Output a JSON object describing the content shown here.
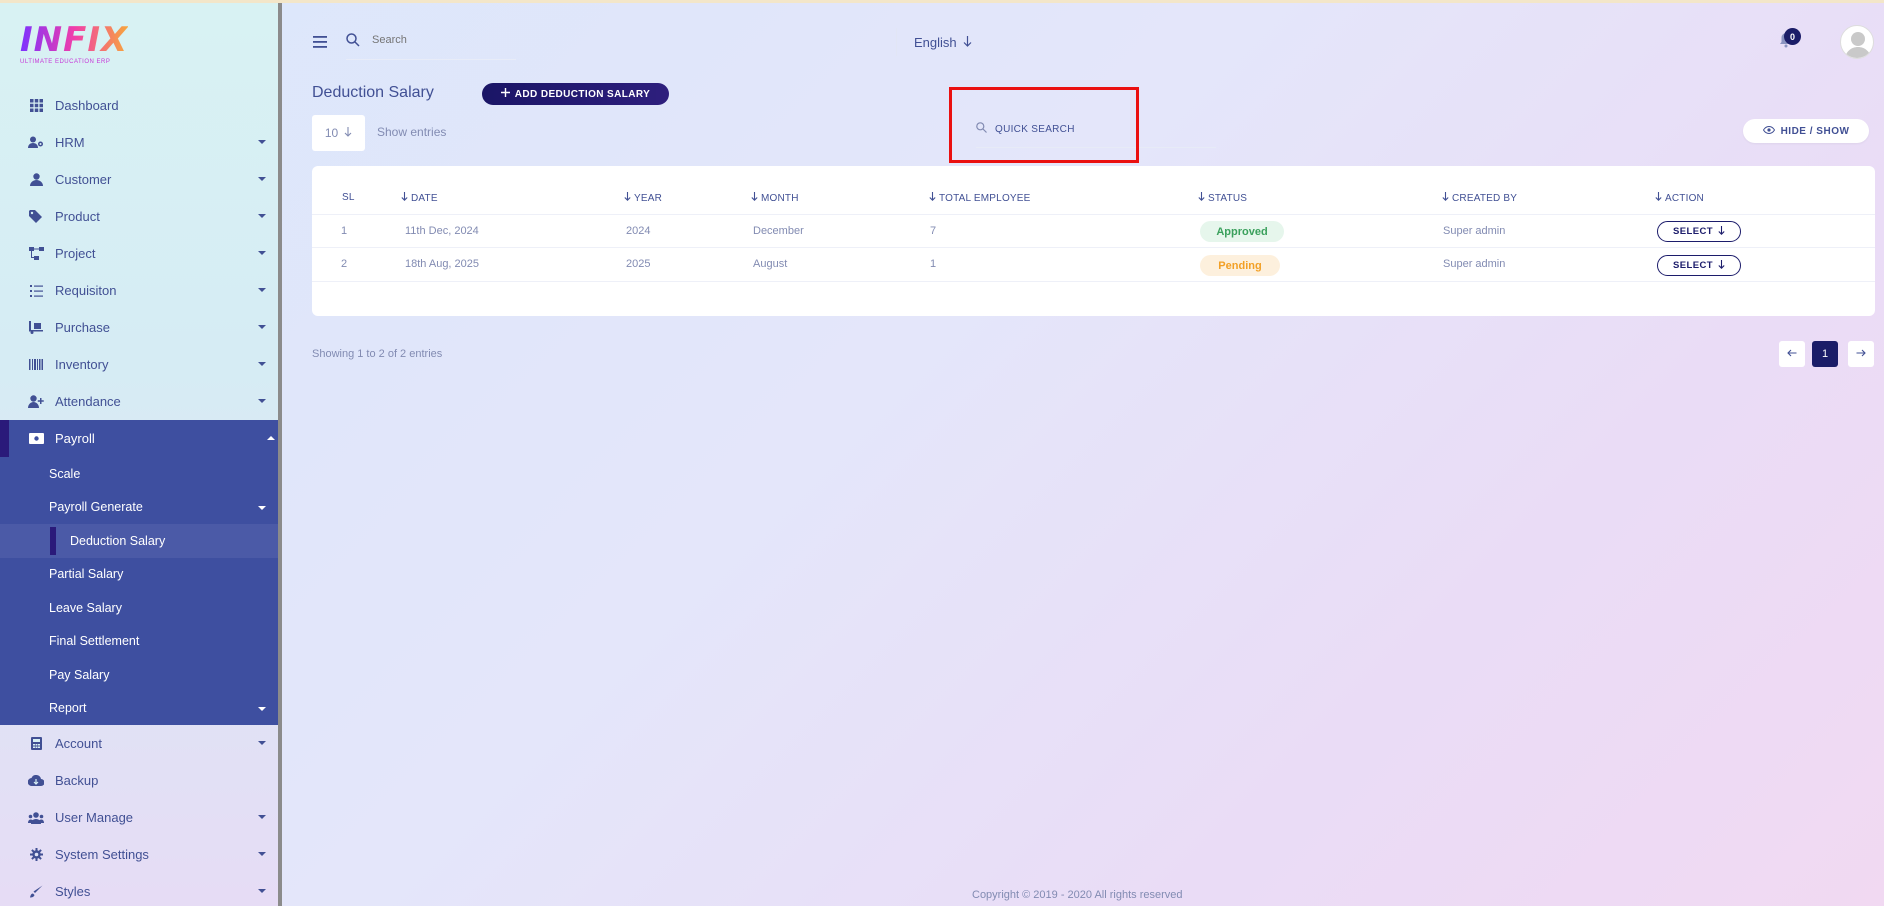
{
  "brand": {
    "logo": "INFIX",
    "tagline": "ULTIMATE EDUCATION ERP"
  },
  "header": {
    "search_placeholder": "Search",
    "language": "English",
    "notification_count": "0"
  },
  "sidebar": {
    "items_top": [
      {
        "label": "Dashboard",
        "icon": "grid-icon"
      },
      {
        "label": "HRM",
        "icon": "users-cog-icon"
      },
      {
        "label": "Customer",
        "icon": "user-icon"
      },
      {
        "label": "Product",
        "icon": "tags-icon"
      },
      {
        "label": "Project",
        "icon": "project-diagram-icon"
      },
      {
        "label": "Requisiton",
        "icon": "list-icon"
      },
      {
        "label": "Purchase",
        "icon": "dolly-icon"
      },
      {
        "label": "Inventory",
        "icon": "barcode-icon"
      },
      {
        "label": "Attendance",
        "icon": "user-plus-icon"
      }
    ],
    "payroll": {
      "label": "Payroll",
      "children": [
        "Scale",
        "Payroll Generate",
        "Deduction Salary",
        "Partial Salary",
        "Leave Salary",
        "Final Settlement",
        "Pay Salary",
        "Report"
      ]
    },
    "items_bottom": [
      {
        "label": "Account",
        "icon": "calculator-icon"
      },
      {
        "label": "Backup",
        "icon": "cloud-icon"
      },
      {
        "label": "User Manage",
        "icon": "users-icon"
      },
      {
        "label": "System Settings",
        "icon": "gear-icon"
      },
      {
        "label": "Styles",
        "icon": "brush-icon"
      }
    ]
  },
  "page": {
    "title": "Deduction Salary",
    "add_button": "ADD DEDUCTION SALARY",
    "entries_value": "10",
    "entries_label": "Show entries",
    "quick_search": "QUICK SEARCH",
    "hide_show": "HIDE / SHOW"
  },
  "table": {
    "headers": [
      "SL",
      "DATE",
      "YEAR",
      "MONTH",
      "TOTAL EMPLOYEE",
      "STATUS",
      "CREATED BY",
      "ACTION"
    ],
    "rows": [
      {
        "sl": "1",
        "date": "11th Dec, 2024",
        "year": "2024",
        "month": "December",
        "total": "7",
        "status": "Approved",
        "created_by": "Super admin",
        "action": "SELECT"
      },
      {
        "sl": "2",
        "date": "18th Aug, 2025",
        "year": "2025",
        "month": "August",
        "total": "1",
        "status": "Pending",
        "created_by": "Super admin",
        "action": "SELECT"
      }
    ]
  },
  "pagination": {
    "summary": "Showing 1 to 2 of 2 entries",
    "current_page": "1"
  },
  "footer": {
    "copyright": "Copyright © 2019 - 2020 All rights reserved"
  },
  "colors": {
    "primary": "#415094",
    "accent": "#1b1d68",
    "highlight": "#ea1010",
    "sidebar_active": "#3e4fa0"
  }
}
